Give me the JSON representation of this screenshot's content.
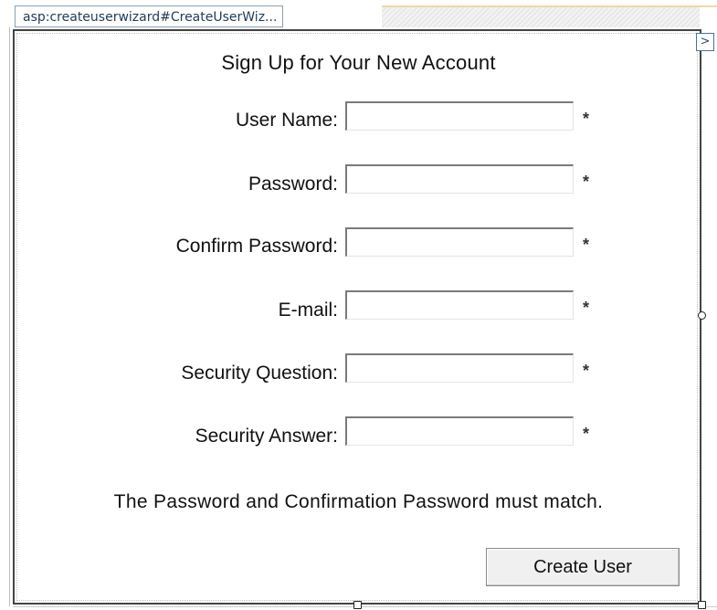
{
  "designer": {
    "control_tag": "asp:createuserwizard#CreateUserWiz...",
    "smart_tag_glyph": ">"
  },
  "wizard": {
    "title": "Sign Up for Your New Account",
    "fields": [
      {
        "label": "User Name:",
        "value": "",
        "required_mark": "*"
      },
      {
        "label": "Password:",
        "value": "",
        "required_mark": "*"
      },
      {
        "label": "Confirm Password:",
        "value": "",
        "required_mark": "*"
      },
      {
        "label": "E-mail:",
        "value": "",
        "required_mark": "*"
      },
      {
        "label": "Security Question:",
        "value": "",
        "required_mark": "*"
      },
      {
        "label": "Security Answer:",
        "value": "",
        "required_mark": "*"
      }
    ],
    "compare_message": "The Password and Confirmation Password must match.",
    "create_button_label": "Create User"
  }
}
